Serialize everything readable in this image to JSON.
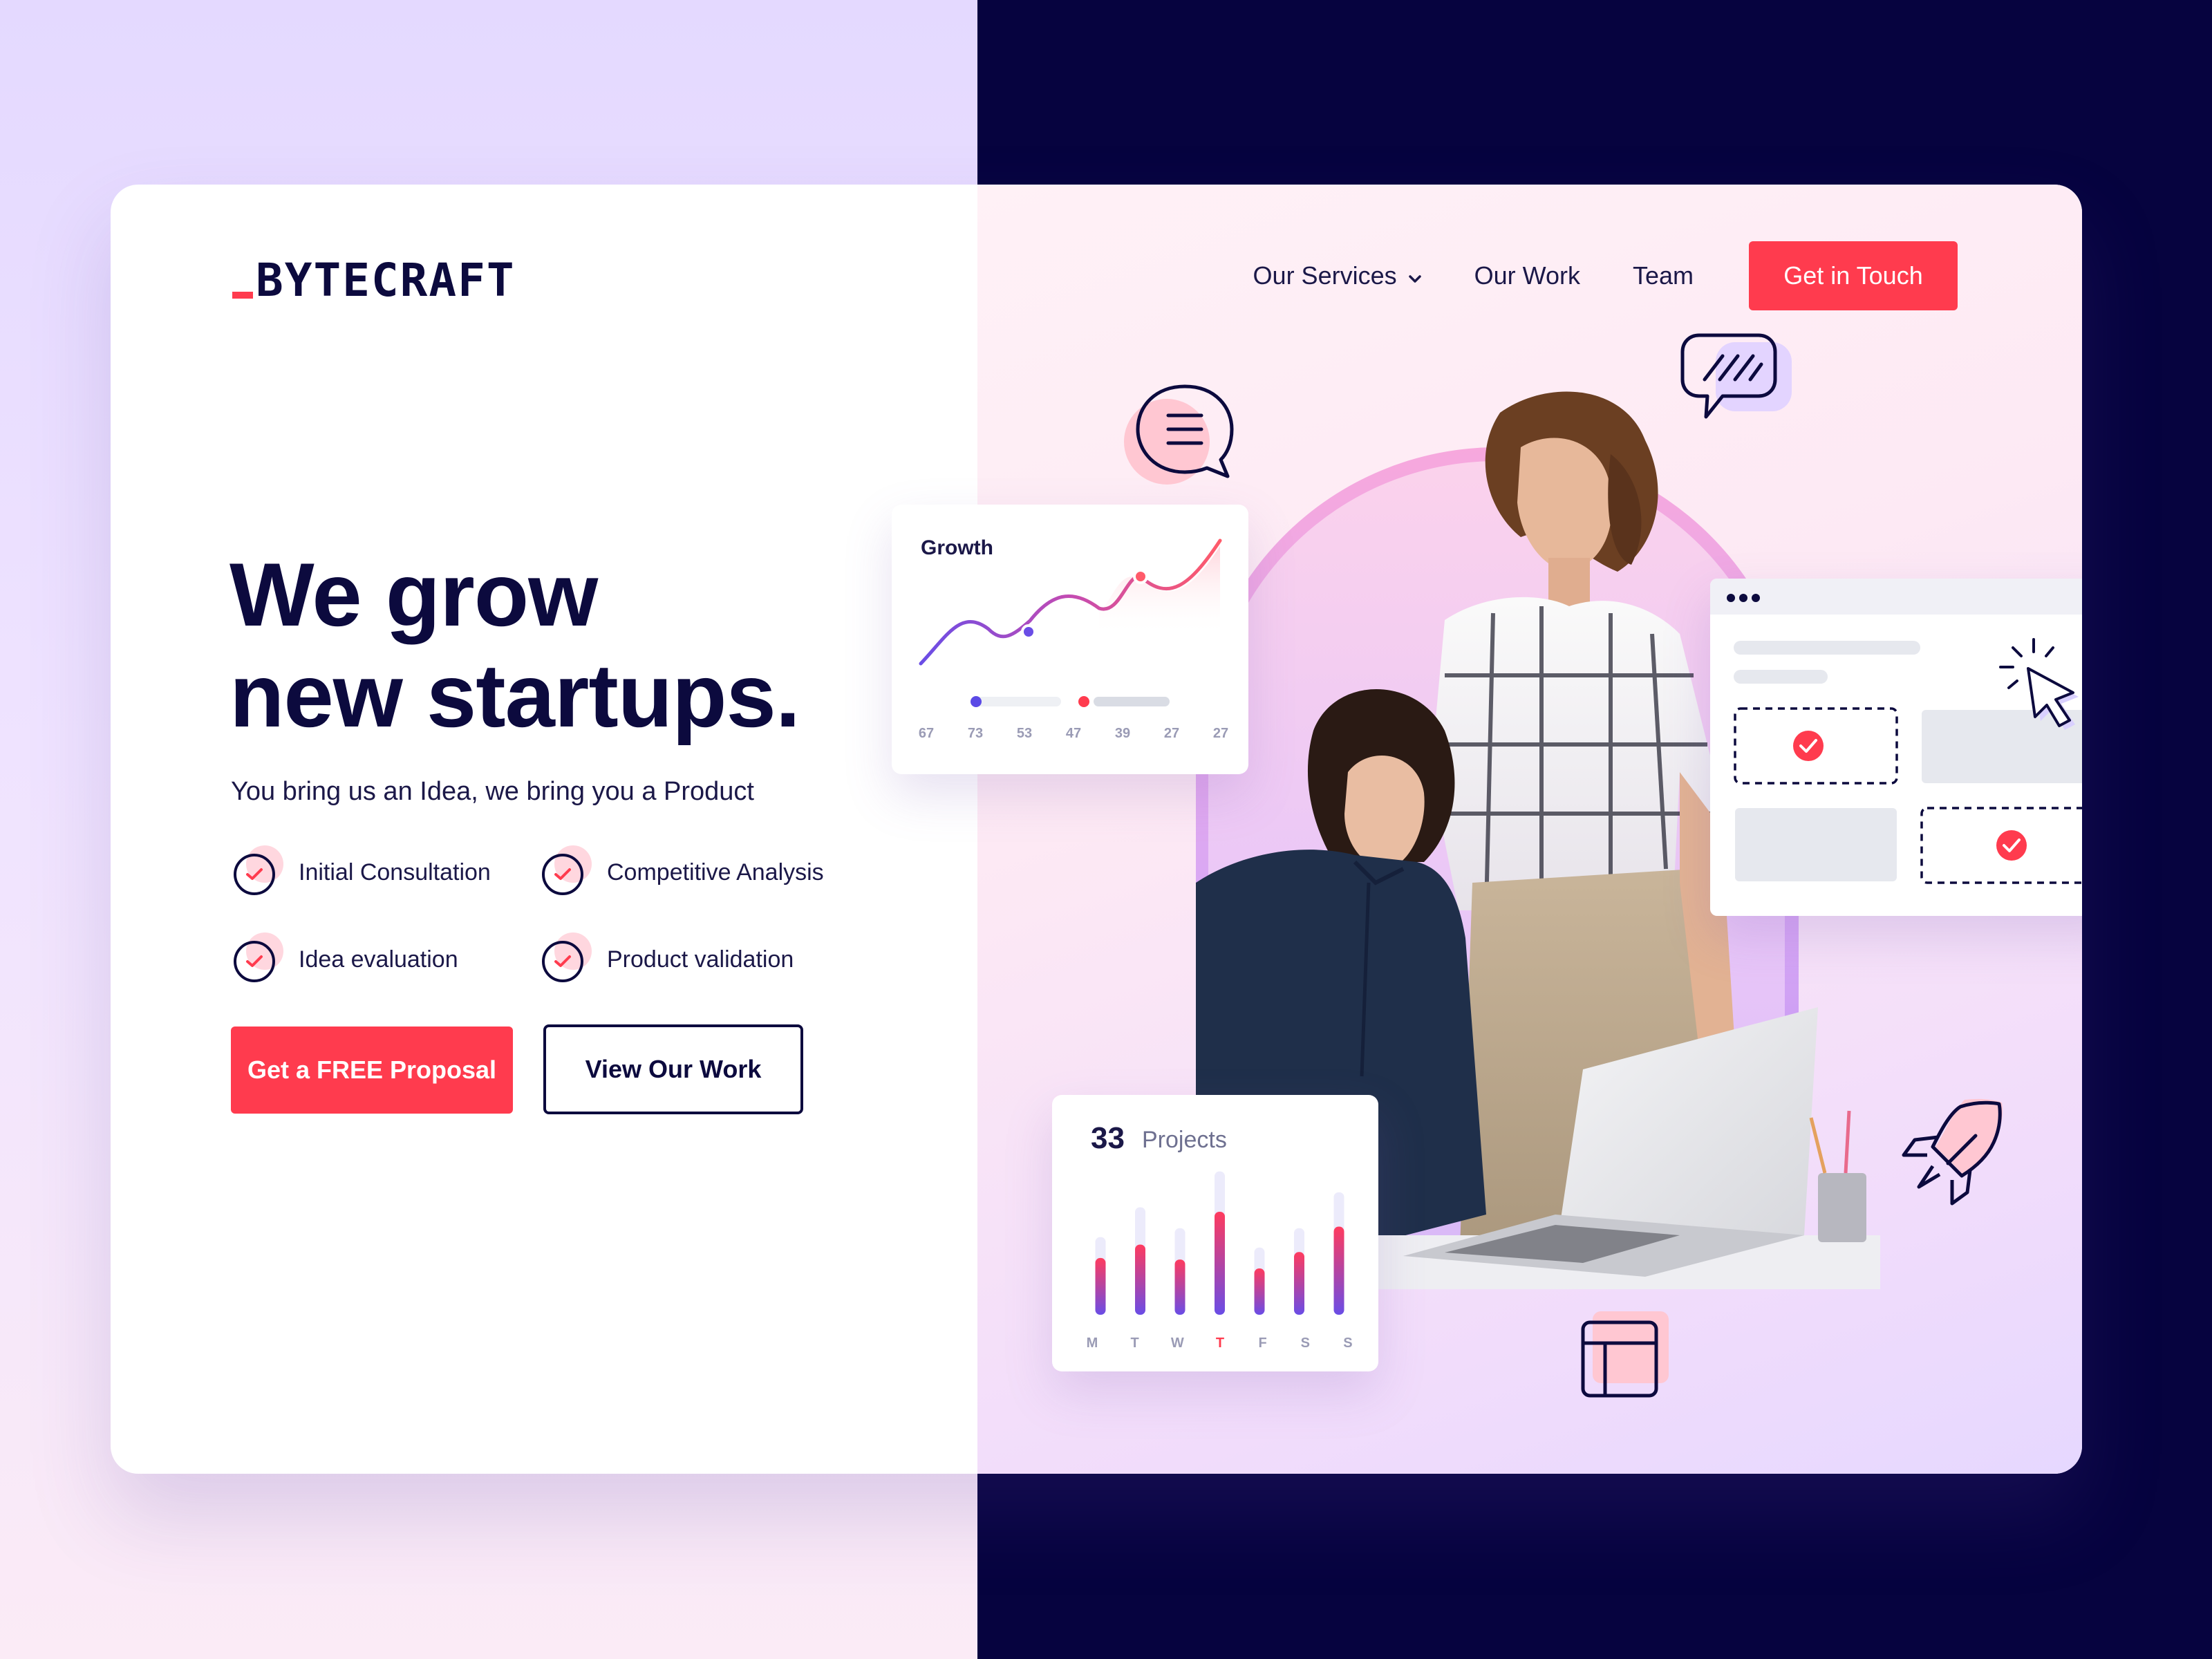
{
  "brand": {
    "logo_text": "BYTECRAFT",
    "accent": "#ff3b4e",
    "navy": "#0c0a3e"
  },
  "nav": {
    "services_label": "Our Services",
    "work_label": "Our Work",
    "team_label": "Team",
    "cta_label": "Get in Touch"
  },
  "hero": {
    "title_line1": "We grow",
    "title_line2": "new startups.",
    "subtitle": "You bring us an Idea, we bring you a Product",
    "features": [
      {
        "label": "Initial Consultation",
        "icon": "check-circle-icon"
      },
      {
        "label": "Competitive Analysis",
        "icon": "check-circle-icon"
      },
      {
        "label": "Idea evaluation",
        "icon": "check-circle-icon"
      },
      {
        "label": "Product validation",
        "icon": "check-circle-icon"
      }
    ],
    "primary_button": "Get a FREE Proposal",
    "secondary_button": "View Our Work"
  },
  "growth_widget": {
    "title": "Growth",
    "labels": [
      "67",
      "73",
      "53",
      "47",
      "39",
      "27",
      "27"
    ]
  },
  "projects_widget": {
    "count": "33",
    "label": "Projects",
    "days": [
      "M",
      "T",
      "W",
      "T",
      "F",
      "S",
      "S"
    ],
    "active_day_index": 3,
    "bar_fill_fraction": [
      0.38,
      0.47,
      0.37,
      0.69,
      0.31,
      0.42,
      0.59
    ],
    "bar_track_fraction": [
      0.52,
      0.72,
      0.58,
      0.96,
      0.45,
      0.58,
      0.82
    ]
  },
  "decor_icons": [
    "chat-bubble-lines-icon",
    "chat-bubble-slashes-icon",
    "cursor-click-icon",
    "rocket-icon",
    "layout-icon"
  ]
}
